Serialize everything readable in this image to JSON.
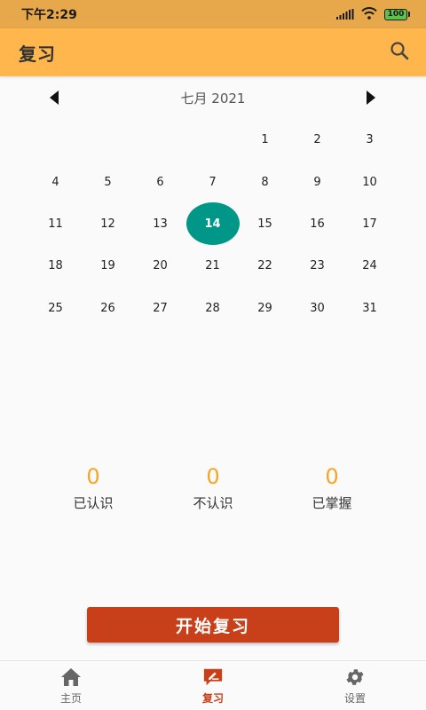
{
  "status_bar": {
    "time": "下午2:29",
    "battery": "100"
  },
  "app_bar": {
    "title": "复习",
    "search_icon": "search-icon"
  },
  "calendar": {
    "month_label": "七月 2021",
    "prev_icon": "chevron-left-icon",
    "next_icon": "chevron-right-icon",
    "leading_blanks": 4,
    "days": [
      "1",
      "2",
      "3",
      "4",
      "5",
      "6",
      "7",
      "8",
      "9",
      "10",
      "11",
      "12",
      "13",
      "14",
      "15",
      "16",
      "17",
      "18",
      "19",
      "20",
      "21",
      "22",
      "23",
      "24",
      "25",
      "26",
      "27",
      "28",
      "29",
      "30",
      "31"
    ],
    "selected_day": "14",
    "selected_color": "#009688"
  },
  "stats": [
    {
      "value": "0",
      "label": "已认识"
    },
    {
      "value": "0",
      "label": "不认识"
    },
    {
      "value": "0",
      "label": "已掌握"
    }
  ],
  "start_button": {
    "label": "开始复习",
    "color": "#c8401a"
  },
  "bottom_nav": [
    {
      "label": "主页",
      "icon": "home-icon",
      "active": false
    },
    {
      "label": "复习",
      "icon": "review-icon",
      "active": true
    },
    {
      "label": "设置",
      "icon": "gear-icon",
      "active": false
    }
  ],
  "colors": {
    "app_bar": "#ffb74d",
    "status_bar": "#e6a84a",
    "stat_number": "#f5a623"
  }
}
